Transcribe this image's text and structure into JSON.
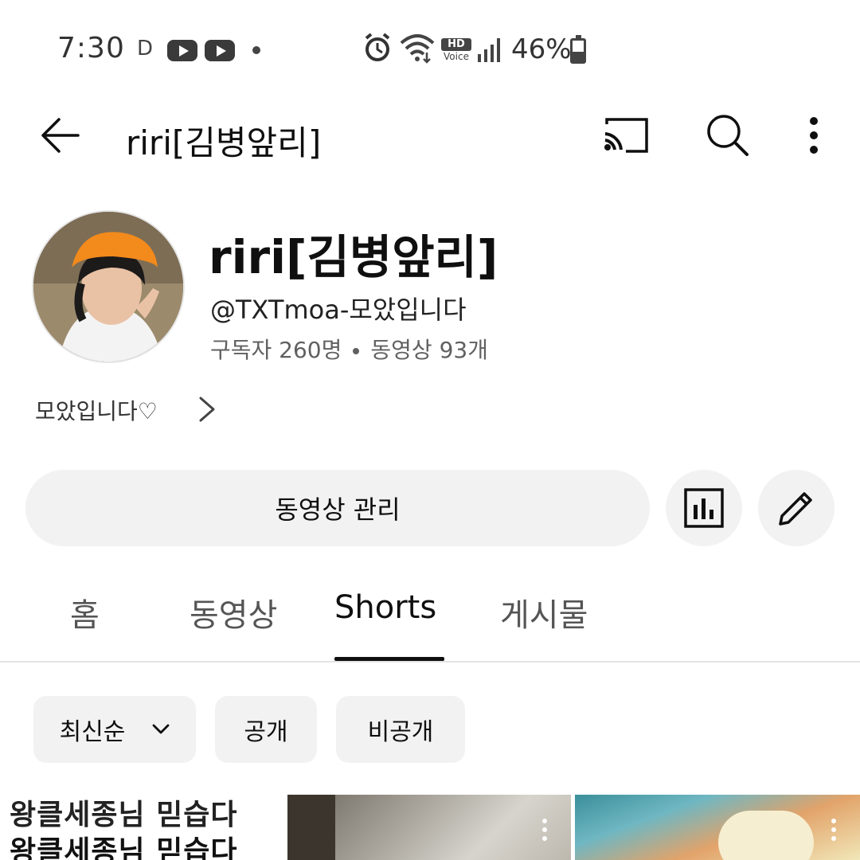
{
  "status_bar": {
    "time": "7:30",
    "indicator": "D",
    "battery_text": "46%",
    "battery_level": 0.46,
    "icons": [
      "youtube-icon",
      "youtube-icon",
      "alarm-icon",
      "wifi-icon",
      "hd-voice-icon",
      "signal-icon",
      "battery-charging-icon"
    ],
    "hd_label": "HD",
    "voice_label": "Voice"
  },
  "topbar": {
    "title": "riri[김병앞리]",
    "icons": [
      "back-arrow-icon",
      "cast-icon",
      "search-icon",
      "more-vert-icon"
    ]
  },
  "channel": {
    "name": "riri[김병앞리]",
    "handle": "@TXTmoa-모았입니다",
    "subscribers": "구독자 260명",
    "videos": "동영상 93개",
    "description": "모았입니다♡"
  },
  "actions": {
    "manage_label": "동영상 관리",
    "icons": [
      "analytics-icon",
      "edit-pencil-icon"
    ]
  },
  "tabs": [
    {
      "label": "홈",
      "active": false
    },
    {
      "label": "동영상",
      "active": false
    },
    {
      "label": "Shorts",
      "active": true
    },
    {
      "label": "게시물",
      "active": false
    }
  ],
  "filters": {
    "sort_label": "최신순",
    "public_label": "공개",
    "private_label": "비공개"
  },
  "shorts": [
    {
      "line1": "왕클세종님 믿습다",
      "line2": "왕클세종님 믿습다"
    },
    {
      "line1": "",
      "line2": ""
    },
    {
      "line1": "",
      "line2": ""
    }
  ],
  "colors": {
    "background": "#ffffff",
    "chip_bg": "#f2f2f2",
    "text_primary": "#0f0f0f",
    "text_secondary": "#606060",
    "divider": "#e5e5e5"
  }
}
